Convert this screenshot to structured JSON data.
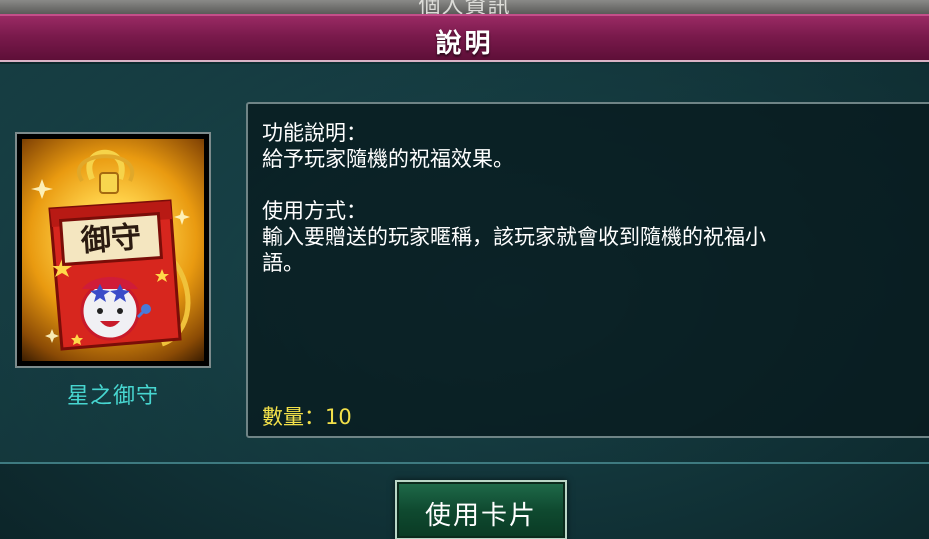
{
  "header": {
    "top_strip_title": "個人資訊",
    "title": "說明"
  },
  "item": {
    "name": "星之御守",
    "charm_label": "御守",
    "icon": "star-omamori-charm"
  },
  "description": {
    "function_heading": "功能說明：",
    "function_text": "給予玩家隨機的祝福效果。",
    "usage_heading": "使用方式：",
    "usage_text_line1": "輸入要贈送的玩家暱稱，該玩家就會收到隨機的祝福小",
    "usage_text_line2": "語。",
    "quantity_label": "數量：",
    "quantity_value": "10"
  },
  "actions": {
    "use_card_label": "使用卡片"
  },
  "colors": {
    "title_bar": "#7a1a4c",
    "item_name": "#47d6d0",
    "quantity": "#f2e04a",
    "button": "#0f4a30"
  }
}
